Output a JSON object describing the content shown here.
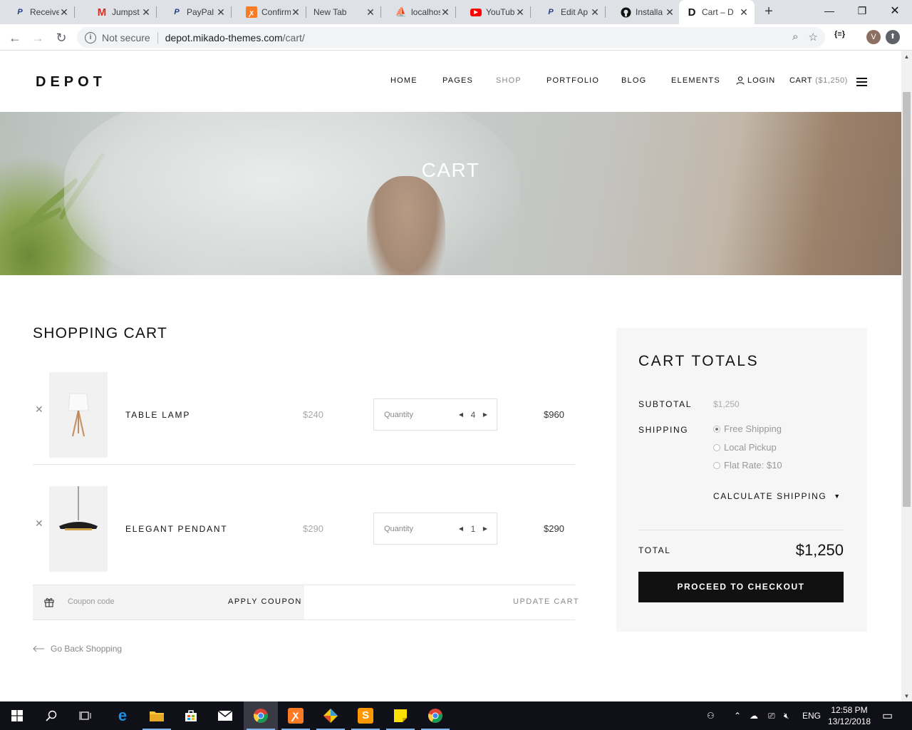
{
  "browser": {
    "tabs": [
      {
        "title": "Receive",
        "favicon": "paypal-icon",
        "color": "#253b80"
      },
      {
        "title": "Jumpst",
        "favicon": "gmail-icon",
        "color": "#d93025"
      },
      {
        "title": "PayPal",
        "favicon": "paypal-icon",
        "color": "#253b80"
      },
      {
        "title": "Confirm",
        "favicon": "xampp-icon",
        "color": "#fb7a24"
      },
      {
        "title": "New Tab",
        "favicon": "",
        "color": ""
      },
      {
        "title": "localhos",
        "favicon": "phpmyadmin-icon",
        "color": "#f89c0e"
      },
      {
        "title": "YouTub",
        "favicon": "youtube-icon",
        "color": "#ff0000"
      },
      {
        "title": "Edit Ap",
        "favicon": "paypal-icon",
        "color": "#253b80"
      },
      {
        "title": "Installa",
        "favicon": "github-icon",
        "color": "#111"
      },
      {
        "title": "Cart – D",
        "favicon": "depot-icon",
        "color": "#111"
      }
    ],
    "security": "Not secure",
    "url_host": "depot.mikado-themes.com",
    "url_path": "/cart/",
    "avatar_letter": "V",
    "extension_label": "{≡}"
  },
  "site": {
    "logo": "DEPOT",
    "menu": [
      "HOME",
      "PAGES",
      "SHOP",
      "PORTFOLIO",
      "BLOG",
      "ELEMENTS"
    ],
    "login": "LOGIN",
    "cart_label": "CART",
    "cart_amount": "($1,250)"
  },
  "hero": {
    "title": "CART"
  },
  "cart": {
    "title": "SHOPPING CART",
    "items": [
      {
        "name": "TABLE LAMP",
        "price": "$240",
        "qty_label": "Quantity",
        "qty": "4",
        "subtotal": "$960"
      },
      {
        "name": "ELEGANT PENDANT",
        "price": "$290",
        "qty_label": "Quantity",
        "qty": "1",
        "subtotal": "$290"
      }
    ],
    "coupon_placeholder": "Coupon code",
    "apply_coupon": "APPLY COUPON",
    "update_cart": "UPDATE CART",
    "go_back": "Go Back Shopping"
  },
  "totals": {
    "title": "CART TOTALS",
    "subtotal_label": "SUBTOTAL",
    "subtotal_value": "$1,250",
    "shipping_label": "SHIPPING",
    "shipping_options": [
      {
        "label": "Free Shipping",
        "selected": true
      },
      {
        "label": "Local Pickup",
        "selected": false
      },
      {
        "label": "Flat Rate: $10",
        "selected": false
      }
    ],
    "calculate_shipping": "CALCULATE SHIPPING",
    "total_label": "TOTAL",
    "total_value": "$1,250",
    "checkout": "PROCEED TO CHECKOUT"
  },
  "taskbar": {
    "language": "ENG",
    "time": "12:58 PM",
    "date": "13/12/2018"
  }
}
